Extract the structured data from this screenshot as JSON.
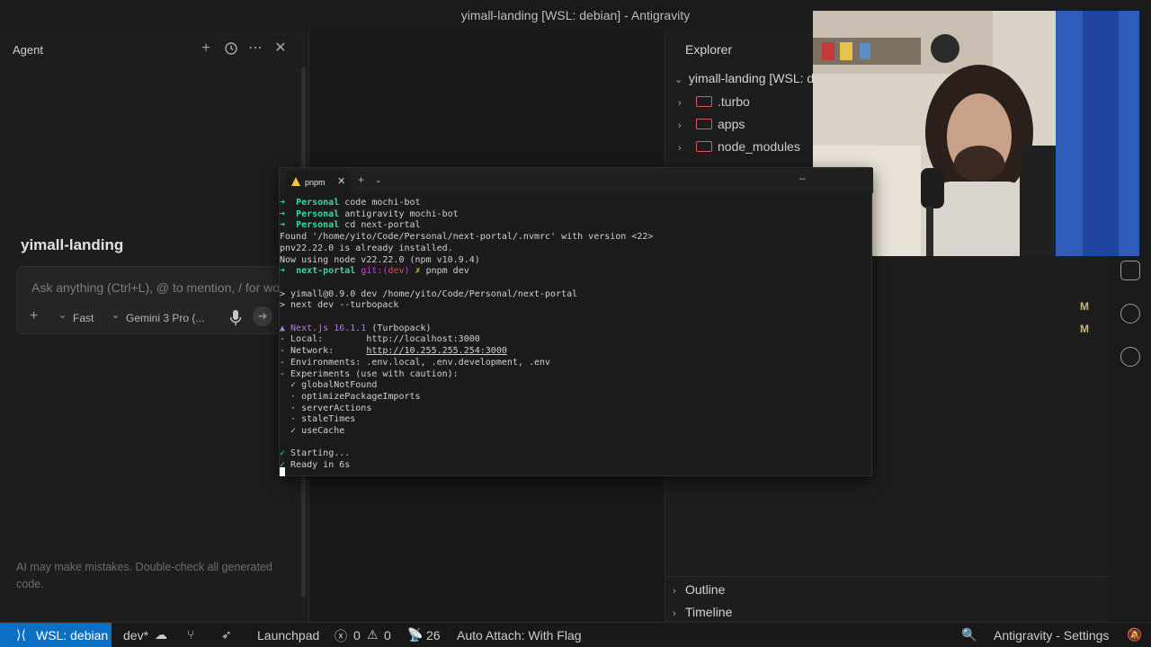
{
  "window": {
    "title": "yimall-landing [WSL: debian] - Antigravity"
  },
  "agent": {
    "header": "Agent",
    "workspace_title": "yimall-landing",
    "input_placeholder": "Ask anything (Ctrl+L), @ to mention, / for workflows",
    "mode": "Fast",
    "model": "Gemini 3 Pro (...",
    "disclaimer": "AI may make mistakes. Double-check all generated code."
  },
  "explorer": {
    "title": "Explorer",
    "root": "yimall-landing [WSL: debian]",
    "items": [
      {
        "name": ".turbo"
      },
      {
        "name": "apps"
      },
      {
        "name": "node_modules"
      }
    ],
    "modified_markers": [
      "M",
      "M"
    ],
    "sections": [
      "Outline",
      "Timeline"
    ]
  },
  "terminal": {
    "tab_label": "pnpm",
    "lines": [
      {
        "parts": [
          {
            "t": "➜  ",
            "c": "c-arrow"
          },
          {
            "t": "Personal",
            "c": "c-ctx"
          },
          {
            "t": " code mochi-bot",
            "c": ""
          }
        ]
      },
      {
        "parts": [
          {
            "t": "➜  ",
            "c": "c-arrow"
          },
          {
            "t": "Personal",
            "c": "c-ctx"
          },
          {
            "t": " antigravity mochi-bot",
            "c": ""
          }
        ]
      },
      {
        "parts": [
          {
            "t": "➜  ",
            "c": "c-arrow"
          },
          {
            "t": "Personal",
            "c": "c-ctx"
          },
          {
            "t": " cd next-portal",
            "c": ""
          }
        ]
      },
      {
        "parts": [
          {
            "t": "Found '/home/yito/Code/Personal/next-portal/.nvmrc' with version <22>",
            "c": ""
          }
        ]
      },
      {
        "parts": [
          {
            "t": "pnv22.22.0 is already installed.",
            "c": ""
          }
        ]
      },
      {
        "parts": [
          {
            "t": "Now using node v22.22.0 (npm v10.9.4)",
            "c": ""
          }
        ]
      },
      {
        "parts": [
          {
            "t": "➜  ",
            "c": "c-arrow"
          },
          {
            "t": "next-portal",
            "c": "c-ctx"
          },
          {
            "t": " git:(",
            "c": "c-git"
          },
          {
            "t": "dev",
            "c": "c-br"
          },
          {
            "t": ")",
            "c": "c-git"
          },
          {
            "t": " ✗ ",
            "c": "c-x"
          },
          {
            "t": "pnpm dev",
            "c": ""
          }
        ]
      },
      {
        "parts": [
          {
            "t": "",
            "c": ""
          }
        ]
      },
      {
        "parts": [
          {
            "t": "> yimall@0.9.0 dev /home/yito/Code/Personal/next-portal",
            "c": ""
          }
        ]
      },
      {
        "parts": [
          {
            "t": "> next dev --turbopack",
            "c": ""
          }
        ]
      },
      {
        "parts": [
          {
            "t": "",
            "c": ""
          }
        ]
      },
      {
        "parts": [
          {
            "t": "▲ Next.js 16.1.1",
            "c": "c-next"
          },
          {
            "t": " (Turbopack)",
            "c": ""
          }
        ]
      },
      {
        "parts": [
          {
            "t": "- Local:        http://localhost:3000",
            "c": ""
          }
        ]
      },
      {
        "parts": [
          {
            "t": "- Network:      ",
            "c": ""
          },
          {
            "t": "http://10.255.255.254:3000",
            "c": "c-url"
          }
        ]
      },
      {
        "parts": [
          {
            "t": "- Environments: .env.local, .env.development, .env",
            "c": ""
          }
        ]
      },
      {
        "parts": [
          {
            "t": "- Experiments (use with caution):",
            "c": ""
          }
        ]
      },
      {
        "parts": [
          {
            "t": "  ✓ globalNotFound",
            "c": ""
          }
        ]
      },
      {
        "parts": [
          {
            "t": "  · optimizePackageImports",
            "c": ""
          }
        ]
      },
      {
        "parts": [
          {
            "t": "  · serverActions",
            "c": ""
          }
        ]
      },
      {
        "parts": [
          {
            "t": "  · staleTimes",
            "c": ""
          }
        ]
      },
      {
        "parts": [
          {
            "t": "  ✓ useCache",
            "c": ""
          }
        ]
      },
      {
        "parts": [
          {
            "t": "",
            "c": ""
          }
        ]
      },
      {
        "parts": [
          {
            "t": "✓ ",
            "c": "c-ok"
          },
          {
            "t": "Starting...",
            "c": ""
          }
        ]
      },
      {
        "parts": [
          {
            "t": "✓ ",
            "c": "c-ok"
          },
          {
            "t": "Ready in 6s",
            "c": ""
          }
        ]
      }
    ]
  },
  "statusbar": {
    "remote": "WSL: debian",
    "branch": "dev*",
    "launchpad": "Launchpad",
    "errors": "0",
    "warnings": "0",
    "ports": "26",
    "auto_attach": "Auto Attach: With Flag",
    "settings": "Antigravity - Settings"
  },
  "colors": {
    "accent": "#0b70c4",
    "folder": "#e05561",
    "terminal_green": "#36d9a4"
  }
}
